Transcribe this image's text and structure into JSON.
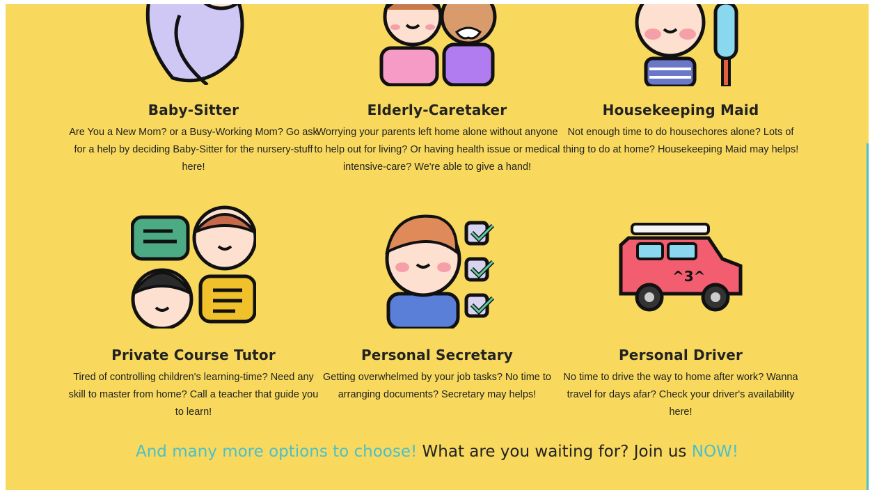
{
  "services": [
    {
      "title": "Baby-Sitter",
      "desc": "Are You a New Mom? or a Busy-Working Mom? Go ask for a help by deciding Baby-Sitter for the nursery-stuff here!",
      "icon": "baby-icon"
    },
    {
      "title": "Elderly-Caretaker",
      "desc": "Worrying your parents left home alone without anyone to help out for living? Or having health issue or medical intensive-care? We're able to give a hand!",
      "icon": "elderly-couple-icon"
    },
    {
      "title": "Housekeeping Maid",
      "desc": "Not enough time to do housechores alone? Lots of thing to do at home? Housekeeping Maid may helps!",
      "icon": "maid-duster-icon"
    },
    {
      "title": "Private Course Tutor",
      "desc": "Tired of controlling children's learning-time? Need any skill to master from home? Call a teacher that guide you to learn!",
      "icon": "tutor-chat-icon"
    },
    {
      "title": "Personal Secretary",
      "desc": "Getting overwhelmed by your job tasks? No time to arranging documents? Secretary may helps!",
      "icon": "secretary-checklist-icon"
    },
    {
      "title": "Personal Driver",
      "desc": "No time to drive the way to home after work? Wanna travel for days afar? Check your driver's availability here!",
      "icon": "car-icon"
    }
  ],
  "cta": {
    "part1": "And many more options to choose!",
    "part2": " What are you waiting for? Join us ",
    "part3": "NOW!"
  },
  "colors": {
    "background": "#f8d95d",
    "accent": "#4cbfc9",
    "text": "#222222"
  }
}
